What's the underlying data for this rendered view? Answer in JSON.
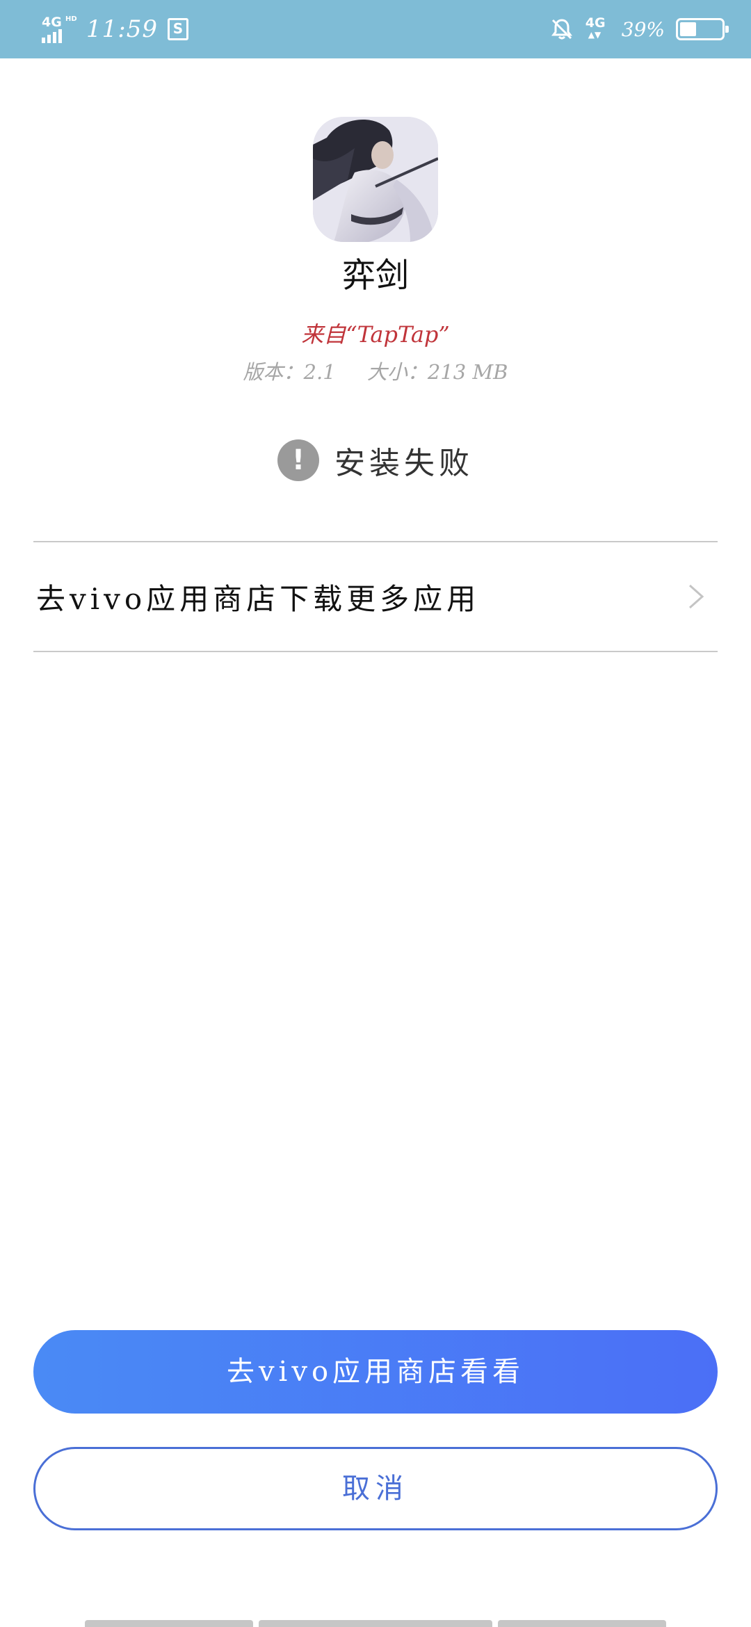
{
  "status_bar": {
    "network_left": "4G",
    "network_left_sup": "HD",
    "time": "11:59",
    "screenshot_icon_letter": "S",
    "network_right": "4G",
    "battery_percent": "39%",
    "battery_level": 0.39,
    "icons": [
      "signal-icon",
      "screenshot-icon",
      "bell-off-icon",
      "mobile-data-icon",
      "battery-icon"
    ]
  },
  "app": {
    "icon": "app-icon",
    "name": "弈剑",
    "source": "来自“TapTap”",
    "version": "版本：2.1",
    "size": "大小：213 MB"
  },
  "install_status": {
    "icon": "warning-icon",
    "text": "安装失败"
  },
  "store_link": {
    "label": "去vivo应用商店下载更多应用",
    "icon": "chevron-right-icon"
  },
  "buttons": {
    "primary": "去vivo应用商店看看",
    "cancel": "取消"
  },
  "colors": {
    "status_bar": "#7fbcd6",
    "source_text": "#c0343a",
    "primary_start": "#4a8af5",
    "primary_end": "#4b6ff6",
    "cancel_border": "#4a6fd6"
  }
}
